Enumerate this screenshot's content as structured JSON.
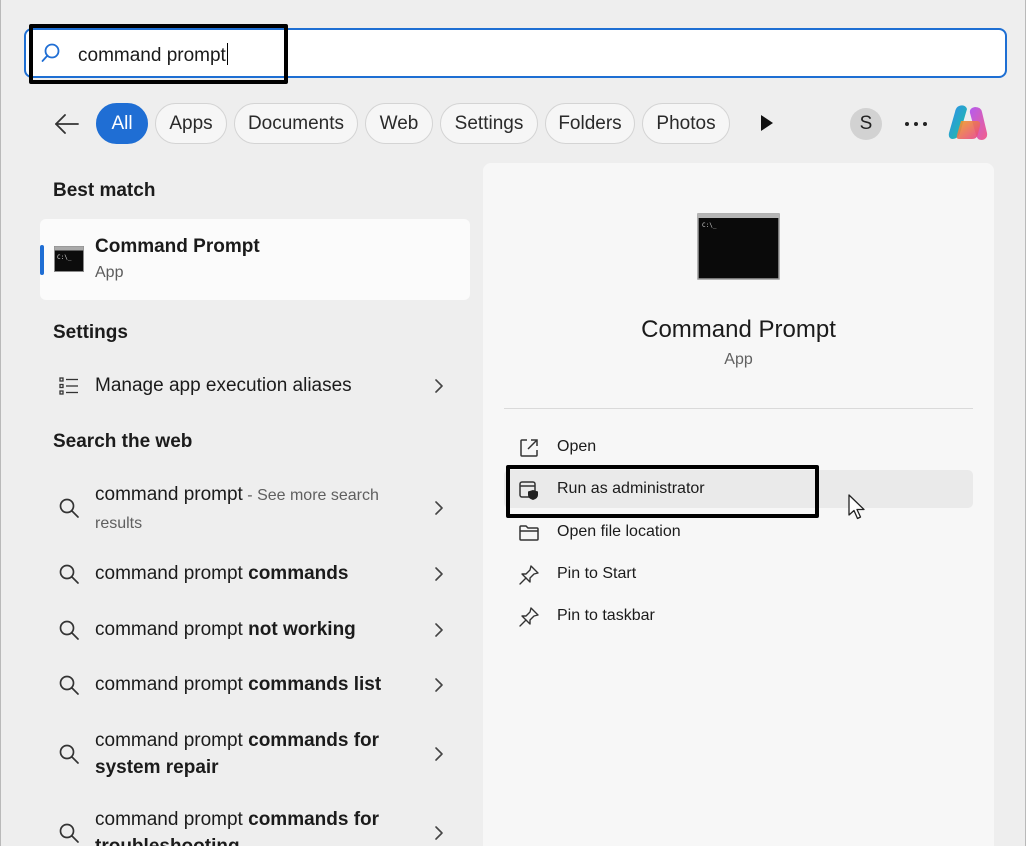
{
  "search": {
    "query": "command prompt"
  },
  "filters": {
    "chips": [
      "All",
      "Apps",
      "Documents",
      "Web",
      "Settings",
      "Folders",
      "Photos"
    ],
    "active": "All",
    "avatar_initial": "S"
  },
  "best_match": {
    "heading": "Best match",
    "title": "Command Prompt",
    "subtitle": "App"
  },
  "settings": {
    "heading": "Settings",
    "items": [
      {
        "label": "Manage app execution aliases"
      }
    ]
  },
  "web": {
    "heading": "Search the web",
    "items": [
      {
        "prefix": "command prompt",
        "bold": "",
        "suffix": " - See more search results"
      },
      {
        "prefix": "command prompt ",
        "bold": "commands",
        "suffix": ""
      },
      {
        "prefix": "command prompt ",
        "bold": "not working",
        "suffix": ""
      },
      {
        "prefix": "command prompt ",
        "bold": "commands list",
        "suffix": ""
      },
      {
        "prefix": "command prompt ",
        "bold": "commands for system repair",
        "suffix": ""
      },
      {
        "prefix": "command prompt ",
        "bold": "commands for troubleshooting",
        "suffix": ""
      }
    ]
  },
  "detail": {
    "title": "Command Prompt",
    "subtitle": "App",
    "actions": [
      {
        "label": "Open",
        "icon": "open-external-icon"
      },
      {
        "label": "Run as administrator",
        "icon": "shield-admin-icon"
      },
      {
        "label": "Open file location",
        "icon": "folder-icon"
      },
      {
        "label": "Pin to Start",
        "icon": "pin-icon"
      },
      {
        "label": "Pin to taskbar",
        "icon": "pin-icon"
      }
    ]
  },
  "colors": {
    "accent": "#1f6ed4",
    "highlight_box": "#000000"
  }
}
